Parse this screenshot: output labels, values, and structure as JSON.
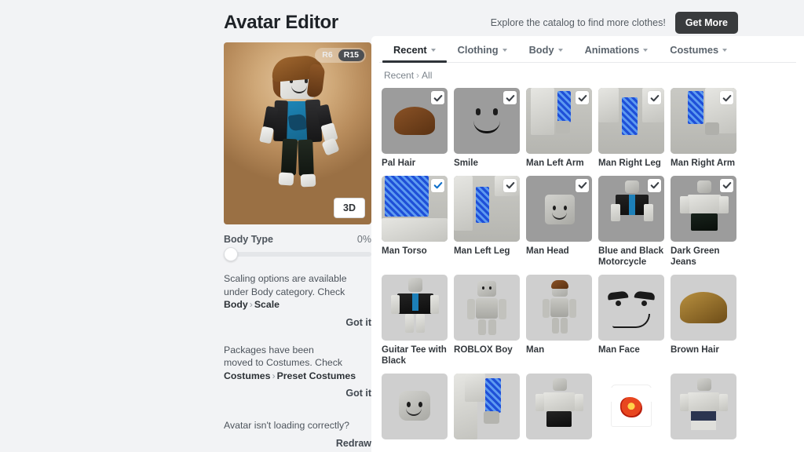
{
  "header": {
    "title": "Avatar Editor",
    "explore_text": "Explore the catalog to find more clothes!",
    "get_more_label": "Get More"
  },
  "avatar_preview": {
    "rig_options": [
      {
        "label": "R6",
        "active": false
      },
      {
        "label": "R15",
        "active": true
      }
    ],
    "view_button_label": "3D"
  },
  "body_type": {
    "label": "Body Type",
    "value_label": "0%",
    "value_percent": 0
  },
  "notices": [
    {
      "text_line1": "Scaling options are available",
      "text_line2": "under Body category. Check",
      "link_primary": "Body",
      "separator": "›",
      "link_secondary": "Scale",
      "action_label": "Got it"
    },
    {
      "text_line1": "Packages have been",
      "text_line2": "moved to Costumes. Check",
      "link_primary": "Costumes",
      "separator": "›",
      "link_secondary": "Preset Costumes",
      "action_label": "Got it"
    }
  ],
  "redraw": {
    "question": "Avatar isn't loading correctly?",
    "action_label": "Redraw"
  },
  "tabs": [
    {
      "label": "Recent",
      "active": true
    },
    {
      "label": "Clothing",
      "active": false
    },
    {
      "label": "Body",
      "active": false
    },
    {
      "label": "Animations",
      "active": false
    },
    {
      "label": "Costumes",
      "active": false
    }
  ],
  "breadcrumb": {
    "root": "Recent",
    "separator": "›",
    "current": "All"
  },
  "items": [
    {
      "label": "Pal Hair",
      "checked": true,
      "check_color": "#3a3f45",
      "art": "pal-hair",
      "bg": "dark"
    },
    {
      "label": "Smile",
      "checked": true,
      "check_color": "#3a3f45",
      "art": "smile",
      "bg": "dark"
    },
    {
      "label": "Man Left Arm",
      "checked": true,
      "check_color": "#3a3f45",
      "art": "left-arm",
      "bg": "dark"
    },
    {
      "label": "Man Right Leg",
      "checked": true,
      "check_color": "#3a3f45",
      "art": "right-leg",
      "bg": "dark"
    },
    {
      "label": "Man Right Arm",
      "checked": true,
      "check_color": "#3a3f45",
      "art": "right-arm",
      "bg": "dark"
    },
    {
      "label": "Man Torso",
      "checked": true,
      "check_color": "#0d6ec9",
      "art": "torso",
      "bg": "dark"
    },
    {
      "label": "Man Left Leg",
      "checked": true,
      "check_color": "#3a3f45",
      "art": "left-leg",
      "bg": "dark"
    },
    {
      "label": "Man Head",
      "checked": true,
      "check_color": "#3a3f45",
      "art": "head",
      "bg": "dark"
    },
    {
      "label": "Blue and Black Motorcycle",
      "checked": true,
      "check_color": "#3a3f45",
      "art": "motorcycle",
      "bg": "dark"
    },
    {
      "label": "Dark Green Jeans",
      "checked": true,
      "check_color": "#3a3f45",
      "art": "green-jeans",
      "bg": "dark"
    },
    {
      "label": "Guitar Tee with Black",
      "checked": false,
      "check_color": "",
      "art": "guitar-tee",
      "bg": "light"
    },
    {
      "label": "ROBLOX Boy",
      "checked": false,
      "check_color": "",
      "art": "roblox-boy",
      "bg": "light"
    },
    {
      "label": "Man",
      "checked": false,
      "check_color": "",
      "art": "man",
      "bg": "light"
    },
    {
      "label": "Man Face",
      "checked": false,
      "check_color": "",
      "art": "man-face",
      "bg": "light"
    },
    {
      "label": "Brown Hair",
      "checked": false,
      "check_color": "",
      "art": "brown-hair",
      "bg": "light"
    },
    {
      "label": "",
      "checked": false,
      "check_color": "",
      "art": "head-plain",
      "bg": "light"
    },
    {
      "label": "",
      "checked": false,
      "check_color": "",
      "art": "blue-arm",
      "bg": "light"
    },
    {
      "label": "",
      "checked": false,
      "check_color": "",
      "art": "dark-shorts",
      "bg": "light"
    },
    {
      "label": "",
      "checked": false,
      "check_color": "",
      "art": "red-tee",
      "bg": "white"
    },
    {
      "label": "",
      "checked": false,
      "check_color": "",
      "art": "striped-legs",
      "bg": "light"
    }
  ],
  "colors": {
    "page_bg": "#f2f3f5",
    "panel_bg": "#ffffff",
    "accent_dark": "#393b3d",
    "check_blue": "#0d6ec9",
    "thumb_dark": "#9c9c9c",
    "thumb_light": "#cfcfcf"
  }
}
